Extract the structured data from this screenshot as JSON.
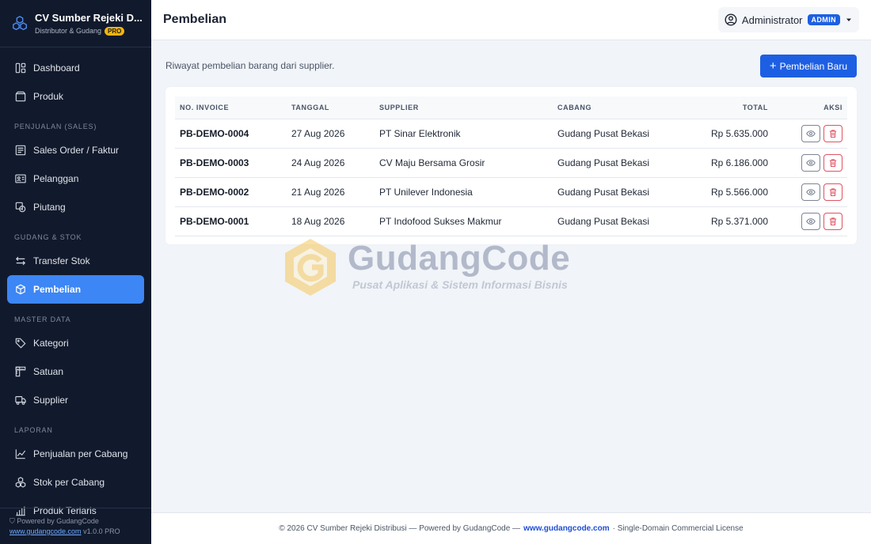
{
  "brand": {
    "title": "CV Sumber Rejeki D...",
    "subtitle": "Distributor & Gudang",
    "badge": "PRO"
  },
  "sidebar": {
    "items": [
      {
        "label": "Dashboard",
        "icon": "dashboard-icon"
      },
      {
        "label": "Produk",
        "icon": "box-icon"
      }
    ],
    "sections": [
      {
        "title": "PENJUALAN (SALES)",
        "items": [
          {
            "label": "Sales Order / Faktur",
            "icon": "document-icon"
          },
          {
            "label": "Pelanggan",
            "icon": "id-card-icon"
          },
          {
            "label": "Piutang",
            "icon": "money-icon"
          }
        ]
      },
      {
        "title": "GUDANG & STOK",
        "items": [
          {
            "label": "Transfer Stok",
            "icon": "swap-arrows-icon"
          },
          {
            "label": "Pembelian",
            "icon": "box-icon",
            "active": true
          }
        ]
      },
      {
        "title": "MASTER DATA",
        "items": [
          {
            "label": "Kategori",
            "icon": "tag-icon"
          },
          {
            "label": "Satuan",
            "icon": "ruler-icon"
          },
          {
            "label": "Supplier",
            "icon": "truck-icon"
          }
        ]
      },
      {
        "title": "LAPORAN",
        "items": [
          {
            "label": "Penjualan per Cabang",
            "icon": "line-chart-icon"
          },
          {
            "label": "Stok per Cabang",
            "icon": "boxes-icon"
          },
          {
            "label": "Produk Terlaris",
            "icon": "bar-chart-icon"
          }
        ]
      }
    ],
    "footer": {
      "powered": "Powered by GudangCode",
      "link": "www.gudangcode.com",
      "version": "v1.0.0 PRO"
    }
  },
  "topbar": {
    "title": "Pembelian",
    "user": "Administrator",
    "role": "ADMIN"
  },
  "main": {
    "subtitle": "Riwayat pembelian barang dari supplier.",
    "new_button": "Pembelian Baru",
    "columns": [
      "NO. INVOICE",
      "TANGGAL",
      "SUPPLIER",
      "CABANG",
      "TOTAL",
      "AKSI"
    ],
    "rows": [
      {
        "invoice": "PB-DEMO-0004",
        "date": "27 Aug 2026",
        "supplier": "PT Sinar Elektronik",
        "branch": "Gudang Pusat Bekasi",
        "total": "Rp 5.635.000"
      },
      {
        "invoice": "PB-DEMO-0003",
        "date": "24 Aug 2026",
        "supplier": "CV Maju Bersama Grosir",
        "branch": "Gudang Pusat Bekasi",
        "total": "Rp 6.186.000"
      },
      {
        "invoice": "PB-DEMO-0002",
        "date": "21 Aug 2026",
        "supplier": "PT Unilever Indonesia",
        "branch": "Gudang Pusat Bekasi",
        "total": "Rp 5.566.000"
      },
      {
        "invoice": "PB-DEMO-0001",
        "date": "18 Aug 2026",
        "supplier": "PT Indofood Sukses Makmur",
        "branch": "Gudang Pusat Bekasi",
        "total": "Rp 5.371.000"
      }
    ]
  },
  "watermark": {
    "title": "GudangCode",
    "subtitle": "Pusat Aplikasi & Sistem Informasi Bisnis"
  },
  "footer": {
    "prefix": "© 2026 CV Sumber Rejeki Distribusi — Powered by GudangCode —",
    "link": "www.gudangcode.com",
    "suffix": "· Single-Domain Commercial License"
  },
  "colors": {
    "sidebar_bg": "#111a2c",
    "accent": "#1d5fe3",
    "active_nav": "#3d86f5",
    "danger": "#e05262",
    "pro_badge": "#f5b50a"
  }
}
